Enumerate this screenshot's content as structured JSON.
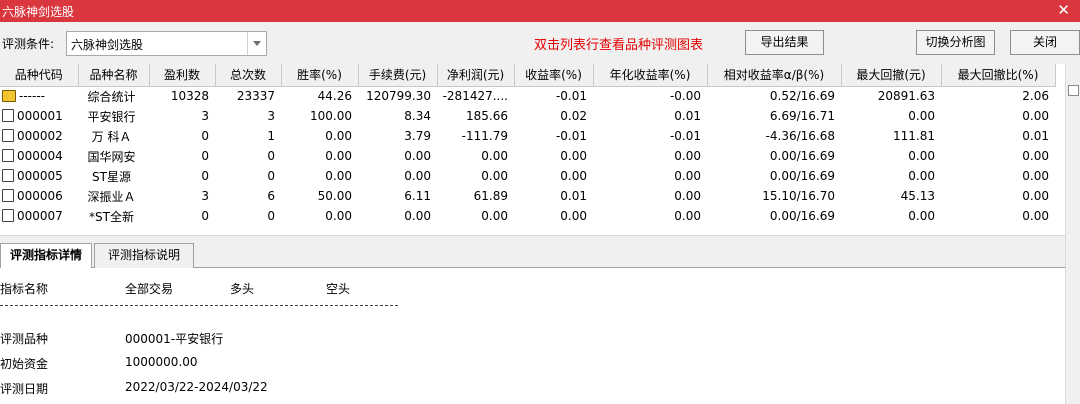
{
  "window": {
    "title": "六脉神剑选股"
  },
  "toolbar": {
    "condition_label": "评测条件:",
    "condition_value": "六脉神剑选股",
    "hint": "双击列表行查看品种评测图表",
    "export_label": "导出结果",
    "switch_label": "切换分析图",
    "close_label": "关闭"
  },
  "grid": {
    "headers": [
      "品种代码",
      "品种名称",
      "盈利数",
      "总次数",
      "胜率(%)",
      "手续费(元)",
      "净利润(元)",
      "收益率(%)",
      "年化收益率(%)",
      "相对收益率α/β(%)",
      "最大回撤(元)",
      "最大回撤比(%)"
    ],
    "rows": [
      [
        "------",
        "综合统计",
        "10328",
        "23337",
        "44.26",
        "120799.30",
        "-281427....",
        "-0.01",
        "-0.00",
        "0.52/16.69",
        "20891.63",
        "2.06"
      ],
      [
        "000001",
        "平安银行",
        "3",
        "3",
        "100.00",
        "8.34",
        "185.66",
        "0.02",
        "0.01",
        "6.69/16.71",
        "0.00",
        "0.00"
      ],
      [
        "000002",
        "万 科Ａ",
        "0",
        "1",
        "0.00",
        "3.79",
        "-111.79",
        "-0.01",
        "-0.01",
        "-4.36/16.68",
        "111.81",
        "0.01"
      ],
      [
        "000004",
        "国华网安",
        "0",
        "0",
        "0.00",
        "0.00",
        "0.00",
        "0.00",
        "0.00",
        "0.00/16.69",
        "0.00",
        "0.00"
      ],
      [
        "000005",
        "ST星源",
        "0",
        "0",
        "0.00",
        "0.00",
        "0.00",
        "0.00",
        "0.00",
        "0.00/16.69",
        "0.00",
        "0.00"
      ],
      [
        "000006",
        "深振业Ａ",
        "3",
        "6",
        "50.00",
        "6.11",
        "61.89",
        "0.01",
        "0.00",
        "15.10/16.70",
        "45.13",
        "0.00"
      ],
      [
        "000007",
        "*ST全新",
        "0",
        "0",
        "0.00",
        "0.00",
        "0.00",
        "0.00",
        "0.00",
        "0.00/16.69",
        "0.00",
        "0.00"
      ]
    ]
  },
  "tabs": {
    "detail": "评测指标详情",
    "explain": "评测指标说明"
  },
  "detail": {
    "col_indicator": "指标名称",
    "col_all": "全部交易",
    "col_long": "多头",
    "col_short": "空头",
    "rows": [
      {
        "label": "评测品种",
        "value": "000001-平安银行"
      },
      {
        "label": "初始资金",
        "value": "1000000.00"
      },
      {
        "label": "评测日期",
        "value": "2022/03/22-2024/03/22"
      }
    ]
  }
}
